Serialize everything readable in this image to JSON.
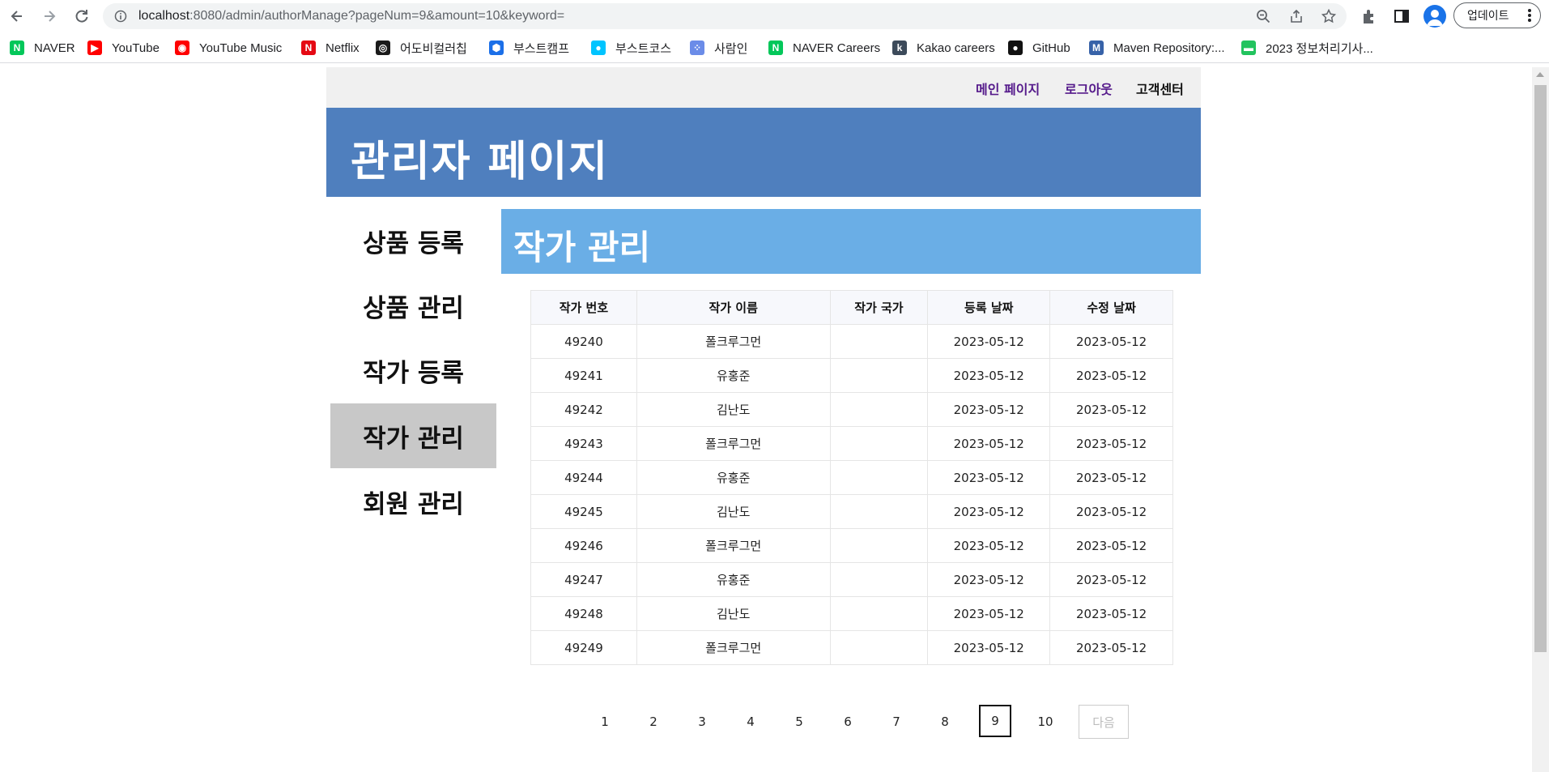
{
  "browser": {
    "url_host": "localhost",
    "url_rest": ":8080/admin/authorManage?pageNum=9&amount=10&keyword=",
    "update_label": "업데이트",
    "bookmarks": [
      {
        "label": "NAVER",
        "icon": "naver-icon",
        "color": "#03c75a",
        "glyph": "N"
      },
      {
        "label": "YouTube",
        "icon": "youtube-icon",
        "color": "#ff0000",
        "glyph": "▶"
      },
      {
        "label": "YouTube Music",
        "icon": "youtube-music-icon",
        "color": "#ff0000",
        "glyph": "◉"
      },
      {
        "label": "Netflix",
        "icon": "netflix-icon",
        "color": "#e50914",
        "glyph": "N"
      },
      {
        "label": "어도비컬러칩",
        "icon": "adobe-color-icon",
        "color": "#1a1a1a",
        "glyph": "◎"
      },
      {
        "label": "부스트캠프",
        "icon": "boostcamp-icon",
        "color": "#1b6fe8",
        "glyph": "⬢"
      },
      {
        "label": "부스트코스",
        "icon": "boostcourse-icon",
        "color": "#00c4ff",
        "glyph": "●"
      },
      {
        "label": "사람인",
        "icon": "saramin-icon",
        "color": "#6b8ce8",
        "glyph": "⁘"
      },
      {
        "label": "NAVER Careers",
        "icon": "naver-careers-icon",
        "color": "#03c75a",
        "glyph": "N"
      },
      {
        "label": "Kakao careers",
        "icon": "kakao-careers-icon",
        "color": "#3c4a5a",
        "glyph": "k"
      },
      {
        "label": "GitHub",
        "icon": "github-icon",
        "color": "#111111",
        "glyph": "●"
      },
      {
        "label": "Maven Repository:...",
        "icon": "maven-icon",
        "color": "#3762a8",
        "glyph": "M"
      },
      {
        "label": "2023 정보처리기사...",
        "icon": "chat-icon",
        "color": "#22c35e",
        "glyph": "▬"
      }
    ]
  },
  "topnav": {
    "main_page": "메인 페이지",
    "logout": "로그아웃",
    "support": "고객센터"
  },
  "header": {
    "title": "관리자 페이지"
  },
  "sidebar": {
    "items": [
      {
        "label": "상품 등록",
        "active": false
      },
      {
        "label": "상품 관리",
        "active": false
      },
      {
        "label": "작가 등록",
        "active": false
      },
      {
        "label": "작가 관리",
        "active": true
      },
      {
        "label": "회원 관리",
        "active": false
      }
    ]
  },
  "content": {
    "title": "작가 관리",
    "columns": [
      "작가 번호",
      "작가 이름",
      "작가 국가",
      "등록 날짜",
      "수정 날짜"
    ],
    "rows": [
      [
        "49240",
        "폴크루그먼",
        "",
        "2023-05-12",
        "2023-05-12"
      ],
      [
        "49241",
        "유홍준",
        "",
        "2023-05-12",
        "2023-05-12"
      ],
      [
        "49242",
        "김난도",
        "",
        "2023-05-12",
        "2023-05-12"
      ],
      [
        "49243",
        "폴크루그먼",
        "",
        "2023-05-12",
        "2023-05-12"
      ],
      [
        "49244",
        "유홍준",
        "",
        "2023-05-12",
        "2023-05-12"
      ],
      [
        "49245",
        "김난도",
        "",
        "2023-05-12",
        "2023-05-12"
      ],
      [
        "49246",
        "폴크루그먼",
        "",
        "2023-05-12",
        "2023-05-12"
      ],
      [
        "49247",
        "유홍준",
        "",
        "2023-05-12",
        "2023-05-12"
      ],
      [
        "49248",
        "김난도",
        "",
        "2023-05-12",
        "2023-05-12"
      ],
      [
        "49249",
        "폴크루그먼",
        "",
        "2023-05-12",
        "2023-05-12"
      ]
    ]
  },
  "pagination": {
    "pages": [
      "1",
      "2",
      "3",
      "4",
      "5",
      "6",
      "7",
      "8",
      "9",
      "10"
    ],
    "current": "9",
    "next_label": "다음"
  },
  "colors": {
    "header_bg": "#4f7fbe",
    "content_title_bg": "#6aaee6",
    "topbar_bg": "#f0f0f0",
    "active_sidebar_bg": "#c8c8c8",
    "link_visited": "#551a8b"
  }
}
